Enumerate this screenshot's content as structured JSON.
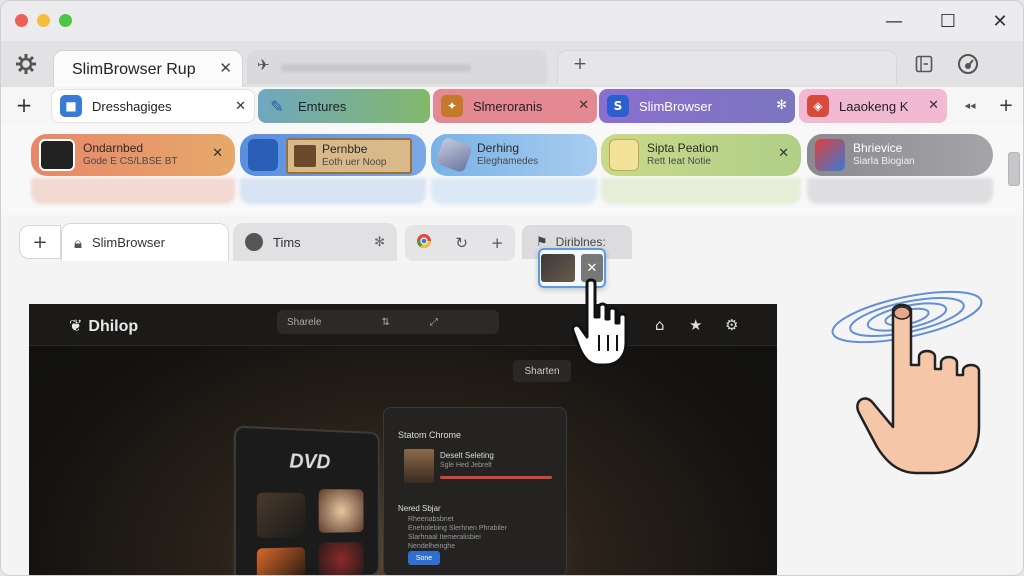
{
  "window": {
    "controls": {
      "minimize": "—",
      "maximize": "☐",
      "close": "✕"
    }
  },
  "row1": {
    "active_tab": {
      "label": "SlimBrowser Rup",
      "close": "✕"
    },
    "new_tab": "+",
    "right_icons": [
      "sidebar-icon",
      "dashboard-icon"
    ]
  },
  "row2": {
    "tabs": [
      {
        "label": "Dresshagiges",
        "close": "✕",
        "color": "#ffffff",
        "icon_color": "#3a7bd5"
      },
      {
        "label": "Emtures",
        "close": "",
        "color": "#7fb06a",
        "icon_color": "#4a90d9"
      },
      {
        "label": "Slmeroranis",
        "close": "✕",
        "color": "#e8858f",
        "icon_color": "#c47a2a"
      },
      {
        "label": "SlimBrowser",
        "close": "",
        "color": "#8372c6",
        "icon_color": "#2b5fcf"
      },
      {
        "label": "Laaokeng K",
        "close": "✕",
        "color": "#f1b9d2",
        "icon_color": "#d84a3a"
      }
    ],
    "more": "◂◂",
    "add": "+"
  },
  "row3": {
    "tabs": [
      {
        "title": "Ondarnbed",
        "sub": "Gode E CS/LBSE BT",
        "color": "#e4926e",
        "close": "✕"
      },
      {
        "title": "Pernbbe",
        "sub": "Eoth uer Noop",
        "color": "#6f9ce0",
        "close": ""
      },
      {
        "title": "Derhing",
        "sub": "Eleghamedes",
        "color": "#9cc3ea",
        "close": ""
      },
      {
        "title": "Sipta Peation",
        "sub": "Rett Ieat Notie",
        "color": "#b9d48a",
        "close": "✕"
      },
      {
        "title": "Bhrievice",
        "sub": "Siarla Biogian",
        "color": "#9a9a9e",
        "close": ""
      }
    ]
  },
  "row4": {
    "add": "+",
    "tab_active": "SlimBrowser",
    "tab_second": "Tims",
    "dragging_tab": "Diriblnes:",
    "pill_icons": [
      "chrome-icon",
      "refresh-icon",
      "plus-icon"
    ]
  },
  "content": {
    "app_logo": "Dhilop",
    "search_text": "Sharele",
    "sub_button": "Sharten",
    "device_label": "DVD",
    "panel": {
      "heading": "Statom Chrome",
      "card_title": "Deselt Seleting",
      "card_sub": "Sgle Hed Jebrelt",
      "list_heading": "Nered Sbjar",
      "items": [
        "Rheenabsbnet",
        "Eneholebing Slerhnen Phrabiler",
        "Slarhnaal Itemeralisbiei",
        "Nendelheinghe"
      ],
      "button": "Sone"
    }
  }
}
